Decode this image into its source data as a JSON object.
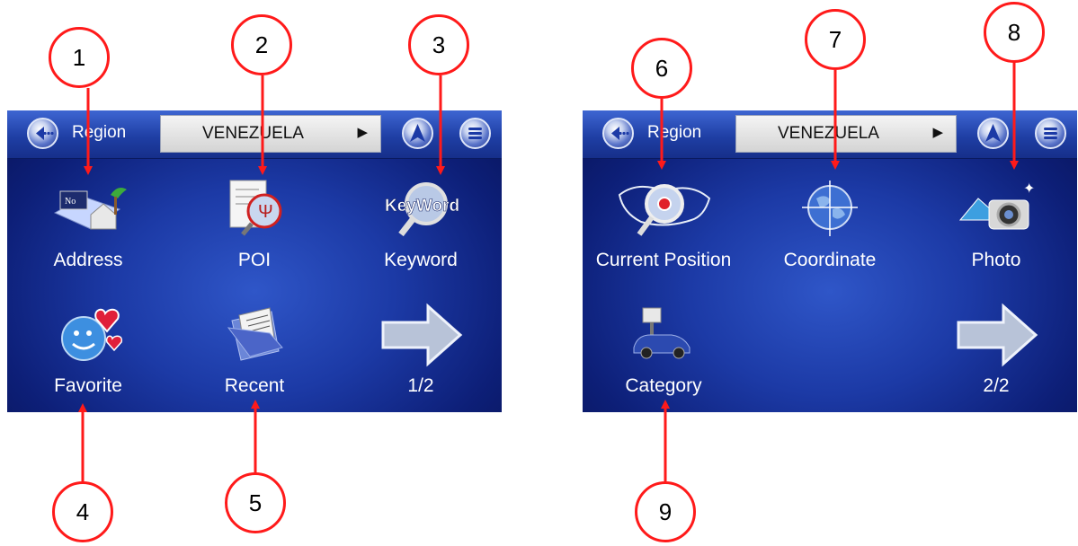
{
  "callouts": [
    "1",
    "2",
    "3",
    "4",
    "5",
    "6",
    "7",
    "8",
    "9"
  ],
  "screens": [
    {
      "region_label": "Region",
      "region_value": "VENEZUELA",
      "region_arrow": "▶",
      "tiles": [
        {
          "label": "Address",
          "icon": "address-icon"
        },
        {
          "label": "POI",
          "icon": "poi-icon"
        },
        {
          "label": "Keyword",
          "icon": "keyword-icon"
        },
        {
          "label": "Favorite",
          "icon": "favorite-icon"
        },
        {
          "label": "Recent",
          "icon": "recent-icon"
        },
        {
          "label": "1/2",
          "icon": "next-arrow-icon"
        }
      ]
    },
    {
      "region_label": "Region",
      "region_value": "VENEZUELA",
      "region_arrow": "▶",
      "tiles": [
        {
          "label": "Current Position",
          "icon": "current-position-icon"
        },
        {
          "label": "Coordinate",
          "icon": "globe-icon"
        },
        {
          "label": "Photo",
          "icon": "camera-icon"
        },
        {
          "label": "Category",
          "icon": "category-car-icon"
        },
        {
          "label": "2/2",
          "icon": "next-arrow-icon"
        }
      ]
    }
  ],
  "colors": {
    "callout_red": "#ff1a1a",
    "screen_blue": "#1c3aa6"
  }
}
